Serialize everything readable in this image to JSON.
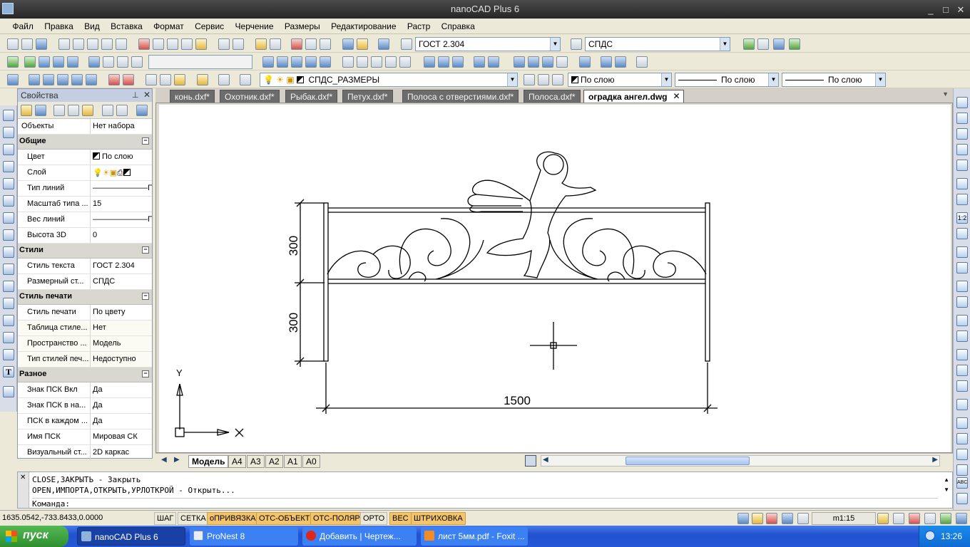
{
  "window": {
    "title": "nanoCAD Plus 6",
    "minimize": "_",
    "maximize": "□",
    "close": "✕"
  },
  "menu": [
    "Файл",
    "Правка",
    "Вид",
    "Вставка",
    "Формат",
    "Сервис",
    "Черчение",
    "Размеры",
    "Редактирование",
    "Растр",
    "Справка"
  ],
  "toolbar": {
    "text_style": "ГОСТ 2.304",
    "dim_style": "СПДС",
    "layer": "СПДС_РАЗМЕРЫ",
    "color": "По слою",
    "linetype": "По слою",
    "lineweight": "По слою"
  },
  "properties": {
    "title": "Свойства",
    "selector_key": "Объекты",
    "selector_value": "Нет набора",
    "categories": [
      {
        "name": "Общие",
        "rows": [
          {
            "k": "Цвет",
            "v": "По слою"
          },
          {
            "k": "Слой",
            "v": ""
          },
          {
            "k": "Тип линий",
            "v": "———————П..."
          },
          {
            "k": "Масштаб типа ...",
            "v": "15"
          },
          {
            "k": "Вес линий",
            "v": "———————П..."
          },
          {
            "k": "Высота 3D",
            "v": "0"
          }
        ]
      },
      {
        "name": "Стили",
        "rows": [
          {
            "k": "Стиль текста",
            "v": "ГОСТ 2.304"
          },
          {
            "k": "Размерный ст...",
            "v": "СПДС"
          }
        ]
      },
      {
        "name": "Стиль печати",
        "rows": [
          {
            "k": "Стиль печати",
            "v": "По цвету"
          },
          {
            "k": "Таблица стиле...",
            "v": "Нет"
          },
          {
            "k": "Пространство ...",
            "v": "Модель"
          },
          {
            "k": "Тип стилей печ...",
            "v": "Недоступно"
          }
        ]
      },
      {
        "name": "Разное",
        "rows": [
          {
            "k": "Знак ПСК Вкл",
            "v": "Да"
          },
          {
            "k": "Знак ПСК в на...",
            "v": "Да"
          },
          {
            "k": "ПСК в каждом ...",
            "v": "Да"
          },
          {
            "k": "Имя ПСК",
            "v": "Мировая СК"
          },
          {
            "k": "Визуальный ст...",
            "v": "2D каркас"
          }
        ]
      }
    ]
  },
  "doc_tabs": [
    "конь.dxf*",
    "Охотник.dxf*",
    "Рыбак.dxf*",
    "Петух.dxf*",
    "Полоса с отверстиями.dxf*",
    "Полоса.dxf*",
    "оградка ангел.dwg"
  ],
  "active_doc_tab": "оградка ангел.dwg",
  "drawing": {
    "dim_top": "300",
    "dim_bottom": "300",
    "dim_width": "1500",
    "ucs_y": "Y",
    "ucs_x": "X"
  },
  "layout_tabs": [
    "Модель",
    "А4",
    "А3",
    "А2",
    "А1",
    "А0"
  ],
  "command": {
    "line1": "CLOSE,ЗАКРЫТЬ - Закрыть",
    "line2": "OPEN,ИМПОРТА,ОТКРЫТЬ,УРЛОТКРОЙ - Открыть...",
    "prompt": "Команда:"
  },
  "status": {
    "coords": "1635.0542,-733.8433,0.0000",
    "buttons": [
      {
        "label": "ШАГ",
        "on": false
      },
      {
        "label": "СЕТКА",
        "on": false
      },
      {
        "label": "оПРИВЯЗКА",
        "on": true
      },
      {
        "label": "ОТС-ОБЪЕКТ",
        "on": true
      },
      {
        "label": "ОТС-ПОЛЯР",
        "on": true
      },
      {
        "label": "ОРТО",
        "on": false
      },
      {
        "label": "ВЕС",
        "on": true
      },
      {
        "label": "ШТРИХОВКА",
        "on": true
      }
    ],
    "scale": "m1:15"
  },
  "taskbar": {
    "start": "пуск",
    "tasks": [
      "nanoCAD Plus 6",
      "ProNest 8",
      "Добавить | Чертеж...",
      "лист 5мм.pdf - Foxit ..."
    ],
    "clock": "13:26"
  },
  "colors": {
    "on_button": "#f4c46a",
    "taskbar": "#2457d6",
    "start": "#3c9e3c"
  }
}
